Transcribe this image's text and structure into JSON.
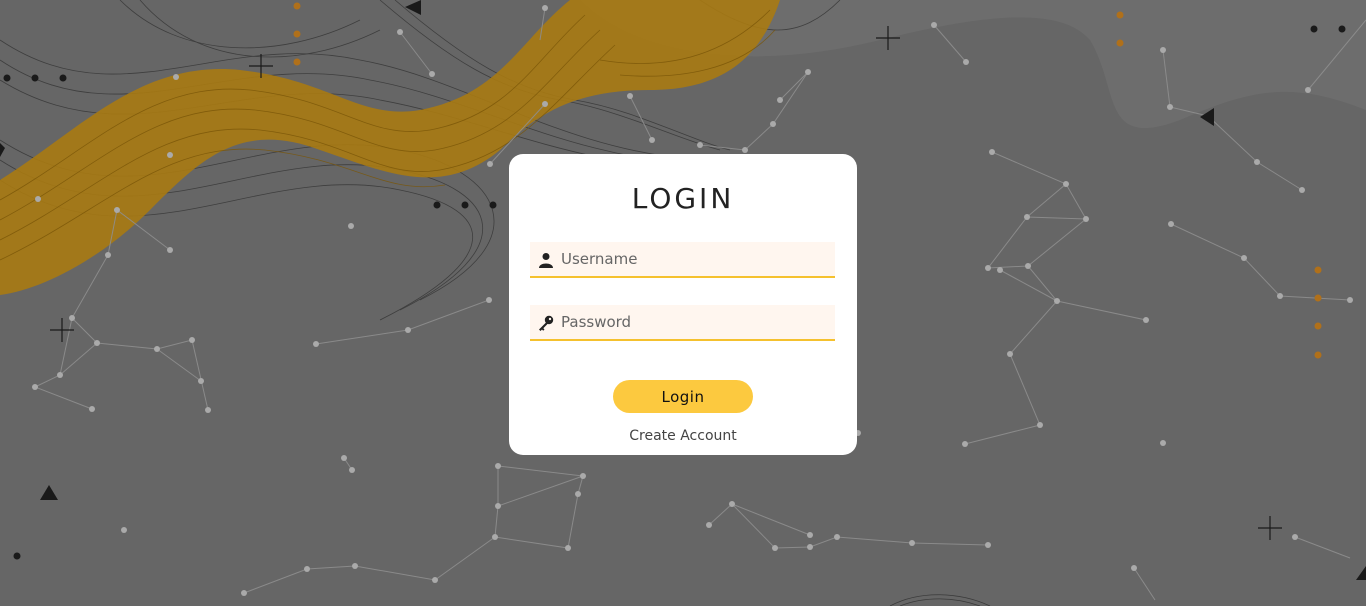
{
  "login": {
    "title": "LOGIN",
    "username": {
      "placeholder": "Username",
      "value": "",
      "icon": "user-icon"
    },
    "password": {
      "placeholder": "Password",
      "value": "",
      "icon": "key-icon"
    },
    "submit_label": "Login",
    "create_account_label": "Create Account"
  },
  "colors": {
    "background": "#666666",
    "accent": "#fcc93f",
    "accent_underline": "#f5c12e",
    "wave": "#b8860b",
    "card": "#ffffff",
    "field_bg": "#fff6ef"
  }
}
